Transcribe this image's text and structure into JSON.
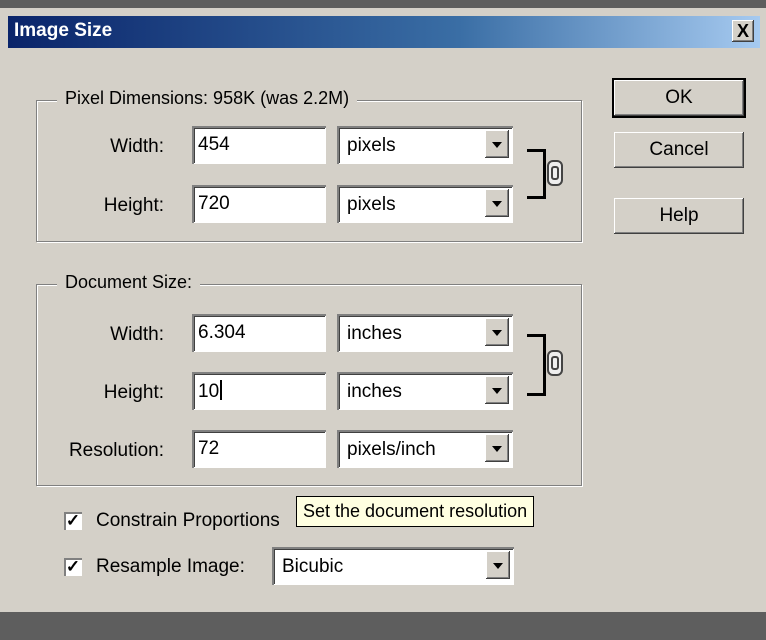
{
  "dialog": {
    "title": "Image Size",
    "close_glyph": "X"
  },
  "pixel_dimensions": {
    "legend": "Pixel Dimensions:  958K (was 2.2M)",
    "width_label": "Width:",
    "width_value": "454",
    "width_unit": "pixels",
    "height_label": "Height:",
    "height_value": "720",
    "height_unit": "pixels"
  },
  "document_size": {
    "legend": "Document Size:",
    "width_label": "Width:",
    "width_value": "6.304",
    "width_unit": "inches",
    "height_label": "Height:",
    "height_value": "10",
    "height_unit": "inches",
    "resolution_label": "Resolution:",
    "resolution_value": "72",
    "resolution_unit": "pixels/inch"
  },
  "options": {
    "constrain_label": "Constrain Proportions",
    "constrain_checked": true,
    "resample_label": "Resample Image:",
    "resample_checked": true,
    "resample_method": "Bicubic",
    "check_glyph": "✓"
  },
  "tooltip": "Set the document resolution",
  "buttons": {
    "ok": "OK",
    "cancel": "Cancel",
    "help": "Help"
  },
  "icons": [
    "close-icon",
    "chain-link-icon",
    "dropdown-arrow-icon",
    "checkmark-icon"
  ]
}
